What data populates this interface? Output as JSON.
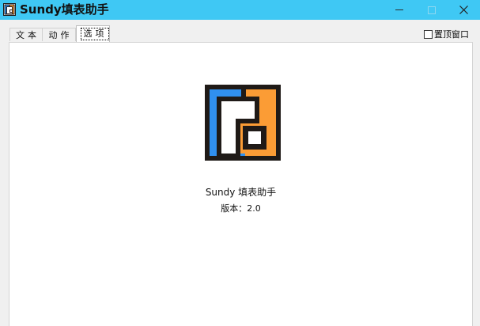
{
  "window": {
    "title": "Sundy填表助手",
    "buttons": {
      "minimize": "minimize",
      "maximize": "maximize",
      "close": "close"
    }
  },
  "tabs": [
    {
      "label": "文本",
      "selected": false
    },
    {
      "label": "动作",
      "selected": false
    },
    {
      "label": "选项",
      "selected": true
    }
  ],
  "topmost": {
    "label": "置顶窗口",
    "checked": false
  },
  "about": {
    "app_name": "Sundy 填表助手",
    "version_label": "版本：",
    "version": "2.0"
  },
  "colors": {
    "titlebar": "#3fc8f4",
    "logo_blue": "#3090ef",
    "logo_orange": "#fb9c35",
    "logo_outline": "#1f1a17"
  },
  "icons": {
    "app": "app-logo-icon",
    "minimize": "minimize-icon",
    "maximize": "maximize-icon",
    "close": "close-icon"
  }
}
